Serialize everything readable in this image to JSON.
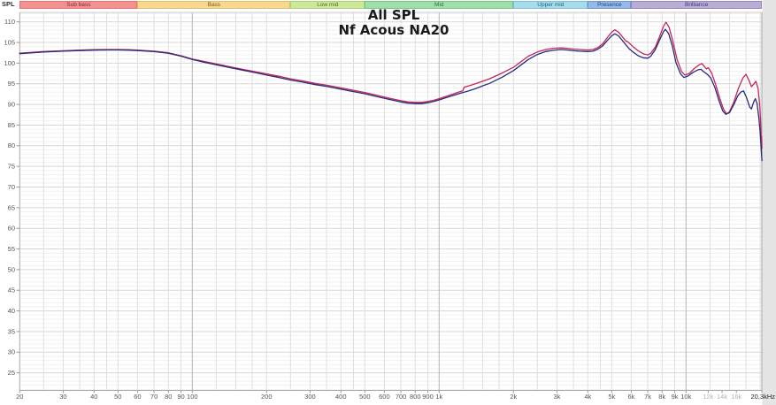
{
  "window": {
    "y_axis_corner_label": "SPL"
  },
  "chart": {
    "title": "All SPL",
    "subtitle": "Nf Acous NA20"
  },
  "colors": {
    "plot_bg": "#ffffff",
    "outside_margin": "#e5e5e5",
    "grid_minor_h": "#f1f1f1",
    "grid_major_h": "#d7d7d7",
    "grid_minor_v": "#dfdfdf",
    "grid_major_v": "#b5b5b5",
    "axis_border": "#a8a8a8",
    "tick_text": "#555555",
    "tick_text_dim": "#b3b3b3",
    "tick_text_edge": "#222222"
  },
  "bands": [
    {
      "label": "Sub bass",
      "f1": 20,
      "f2": 60,
      "fill": "#f59090",
      "border": "#e57373",
      "text": "#7a2e2e"
    },
    {
      "label": "Bass",
      "f1": 60,
      "f2": 250,
      "fill": "#f6d88f",
      "border": "#dfbe68",
      "text": "#6e5a1e"
    },
    {
      "label": "Low mid",
      "f1": 250,
      "f2": 500,
      "fill": "#cce99b",
      "border": "#aed177",
      "text": "#4f6b21"
    },
    {
      "label": "Mid",
      "f1": 500,
      "f2": 2000,
      "fill": "#9fe0aa",
      "border": "#77c487",
      "text": "#2e6e3e"
    },
    {
      "label": "Upper mid",
      "f1": 2000,
      "f2": 4000,
      "fill": "#a8dcec",
      "border": "#7cc0d8",
      "text": "#1f5f78"
    },
    {
      "label": "Presence",
      "f1": 4000,
      "f2": 6000,
      "fill": "#97b9e6",
      "border": "#6f97d0",
      "text": "#24457e"
    },
    {
      "label": "Brilliance",
      "f1": 6000,
      "f2": 20300,
      "fill": "#b7add5",
      "border": "#9588bf",
      "text": "#453a6e"
    }
  ],
  "chart_data": {
    "type": "line",
    "title": "All SPL",
    "subtitle": "Nf Acous NA20",
    "x_scale": "log",
    "x_range_hz": [
      20,
      20300
    ],
    "y_range_db": [
      20.75,
      112.3
    ],
    "ylabel": "SPL",
    "grid": true,
    "legend_position": "none",
    "y_ticks": [
      110,
      105,
      100,
      95,
      90,
      85,
      80,
      75,
      70,
      65,
      60,
      55,
      50,
      45,
      40,
      35,
      30,
      25
    ],
    "x_ticks": [
      {
        "f": 20,
        "label": "20"
      },
      {
        "f": 30,
        "label": "30"
      },
      {
        "f": 40,
        "label": "40"
      },
      {
        "f": 50,
        "label": "50"
      },
      {
        "f": 60,
        "label": "60"
      },
      {
        "f": 70,
        "label": "70"
      },
      {
        "f": 80,
        "label": "80"
      },
      {
        "f": 90,
        "label": "90"
      },
      {
        "f": 100,
        "label": "100"
      },
      {
        "f": 200,
        "label": "200"
      },
      {
        "f": 300,
        "label": "300"
      },
      {
        "f": 400,
        "label": "400"
      },
      {
        "f": 500,
        "label": "500"
      },
      {
        "f": 600,
        "label": "600"
      },
      {
        "f": 700,
        "label": "700"
      },
      {
        "f": 800,
        "label": "800"
      },
      {
        "f": 900,
        "label": "900"
      },
      {
        "f": 1000,
        "label": "1k"
      },
      {
        "f": 2000,
        "label": "2k"
      },
      {
        "f": 3000,
        "label": "3k"
      },
      {
        "f": 4000,
        "label": "4k"
      },
      {
        "f": 5000,
        "label": "5k"
      },
      {
        "f": 6000,
        "label": "6k"
      },
      {
        "f": 7000,
        "label": "7k"
      },
      {
        "f": 8000,
        "label": "8k"
      },
      {
        "f": 9000,
        "label": "9k"
      },
      {
        "f": 10000,
        "label": "10k"
      },
      {
        "f": 12300,
        "label": "12k",
        "dim": true
      },
      {
        "f": 14000,
        "label": "14k",
        "dim": true
      },
      {
        "f": 16000,
        "label": "16k",
        "dim": true
      },
      {
        "f": 20300,
        "label": "20,3kHz",
        "edge": true
      }
    ],
    "grid_minor_multipliers": [
      1,
      1.25,
      1.5,
      1.75,
      2,
      2.5,
      3,
      3.5,
      4,
      4.5,
      5,
      6,
      7,
      8,
      9
    ],
    "grid_major_freqs": [
      100,
      1000,
      10000
    ],
    "series": [
      {
        "name": "trace-red",
        "color": "#c42753",
        "points": [
          [
            20,
            102.4
          ],
          [
            25,
            102.8
          ],
          [
            30,
            103.0
          ],
          [
            35,
            103.15
          ],
          [
            40,
            103.25
          ],
          [
            45,
            103.3
          ],
          [
            50,
            103.3
          ],
          [
            55,
            103.25
          ],
          [
            60,
            103.15
          ],
          [
            70,
            102.9
          ],
          [
            80,
            102.5
          ],
          [
            90,
            101.8
          ],
          [
            100,
            101.0
          ],
          [
            112,
            100.4
          ],
          [
            125,
            99.8
          ],
          [
            140,
            99.2
          ],
          [
            160,
            98.5
          ],
          [
            180,
            97.9
          ],
          [
            200,
            97.4
          ],
          [
            225,
            96.8
          ],
          [
            250,
            96.2
          ],
          [
            280,
            95.7
          ],
          [
            315,
            95.1
          ],
          [
            355,
            94.6
          ],
          [
            400,
            94.0
          ],
          [
            450,
            93.4
          ],
          [
            500,
            92.9
          ],
          [
            560,
            92.2
          ],
          [
            630,
            91.5
          ],
          [
            700,
            90.9
          ],
          [
            750,
            90.6
          ],
          [
            800,
            90.5
          ],
          [
            850,
            90.5
          ],
          [
            900,
            90.7
          ],
          [
            950,
            91.0
          ],
          [
            1000,
            91.4
          ],
          [
            1100,
            92.2
          ],
          [
            1200,
            93.0
          ],
          [
            1245,
            93.3
          ],
          [
            1265,
            94.2
          ],
          [
            1350,
            94.7
          ],
          [
            1500,
            95.6
          ],
          [
            1600,
            96.2
          ],
          [
            1800,
            97.6
          ],
          [
            2000,
            99.0
          ],
          [
            2150,
            100.4
          ],
          [
            2300,
            101.7
          ],
          [
            2500,
            102.7
          ],
          [
            2700,
            103.3
          ],
          [
            2900,
            103.6
          ],
          [
            3100,
            103.7
          ],
          [
            3300,
            103.6
          ],
          [
            3500,
            103.4
          ],
          [
            3700,
            103.3
          ],
          [
            4000,
            103.2
          ],
          [
            4200,
            103.3
          ],
          [
            4400,
            103.8
          ],
          [
            4600,
            104.7
          ],
          [
            4800,
            106.2
          ],
          [
            5000,
            107.5
          ],
          [
            5150,
            108.1
          ],
          [
            5350,
            107.4
          ],
          [
            5550,
            106.2
          ],
          [
            5700,
            105.4
          ],
          [
            5800,
            105.2
          ],
          [
            5900,
            104.8
          ],
          [
            6100,
            104.0
          ],
          [
            6400,
            103.0
          ],
          [
            6700,
            102.3
          ],
          [
            7000,
            102.0
          ],
          [
            7200,
            102.4
          ],
          [
            7500,
            103.8
          ],
          [
            7800,
            106.3
          ],
          [
            8100,
            108.9
          ],
          [
            8300,
            109.9
          ],
          [
            8550,
            108.6
          ],
          [
            8850,
            105.2
          ],
          [
            9200,
            100.9
          ],
          [
            9600,
            97.9
          ],
          [
            9900,
            97.1
          ],
          [
            10300,
            97.5
          ],
          [
            10800,
            98.7
          ],
          [
            11300,
            99.6
          ],
          [
            11600,
            99.9
          ],
          [
            11900,
            99.1
          ],
          [
            12100,
            98.6
          ],
          [
            12300,
            98.9
          ],
          [
            12700,
            97.6
          ],
          [
            13200,
            94.8
          ],
          [
            13700,
            91.5
          ],
          [
            14200,
            88.8
          ],
          [
            14600,
            87.7
          ],
          [
            15000,
            88.2
          ],
          [
            15600,
            90.5
          ],
          [
            16300,
            93.9
          ],
          [
            17000,
            96.4
          ],
          [
            17500,
            97.3
          ],
          [
            18000,
            95.8
          ],
          [
            18400,
            94.3
          ],
          [
            18800,
            94.9
          ],
          [
            19200,
            95.6
          ],
          [
            19600,
            93.8
          ],
          [
            19900,
            89.5
          ],
          [
            20050,
            86.0
          ],
          [
            20150,
            82.0
          ],
          [
            20200,
            80.3
          ],
          [
            20250,
            82.3
          ],
          [
            20300,
            79.3
          ]
        ]
      },
      {
        "name": "trace-blue",
        "color": "#272c7c",
        "points": [
          [
            20,
            102.3
          ],
          [
            25,
            102.7
          ],
          [
            30,
            102.9
          ],
          [
            35,
            103.05
          ],
          [
            40,
            103.15
          ],
          [
            45,
            103.2
          ],
          [
            50,
            103.2
          ],
          [
            55,
            103.15
          ],
          [
            60,
            103.05
          ],
          [
            70,
            102.8
          ],
          [
            80,
            102.4
          ],
          [
            90,
            101.7
          ],
          [
            100,
            100.9
          ],
          [
            112,
            100.2
          ],
          [
            125,
            99.6
          ],
          [
            140,
            99.0
          ],
          [
            160,
            98.3
          ],
          [
            180,
            97.7
          ],
          [
            200,
            97.1
          ],
          [
            225,
            96.5
          ],
          [
            250,
            95.9
          ],
          [
            280,
            95.4
          ],
          [
            315,
            94.8
          ],
          [
            355,
            94.3
          ],
          [
            400,
            93.7
          ],
          [
            450,
            93.1
          ],
          [
            500,
            92.6
          ],
          [
            560,
            91.9
          ],
          [
            630,
            91.2
          ],
          [
            700,
            90.6
          ],
          [
            750,
            90.3
          ],
          [
            800,
            90.2
          ],
          [
            850,
            90.2
          ],
          [
            900,
            90.4
          ],
          [
            950,
            90.7
          ],
          [
            1000,
            91.1
          ],
          [
            1100,
            91.9
          ],
          [
            1200,
            92.6
          ],
          [
            1300,
            93.2
          ],
          [
            1400,
            93.8
          ],
          [
            1500,
            94.5
          ],
          [
            1600,
            95.1
          ],
          [
            1800,
            96.6
          ],
          [
            2000,
            98.2
          ],
          [
            2150,
            99.6
          ],
          [
            2300,
            100.9
          ],
          [
            2500,
            102.1
          ],
          [
            2700,
            102.8
          ],
          [
            2900,
            103.1
          ],
          [
            3100,
            103.3
          ],
          [
            3300,
            103.2
          ],
          [
            3500,
            103.0
          ],
          [
            3700,
            102.9
          ],
          [
            4000,
            102.8
          ],
          [
            4200,
            102.9
          ],
          [
            4400,
            103.4
          ],
          [
            4600,
            104.2
          ],
          [
            4800,
            105.5
          ],
          [
            5000,
            106.6
          ],
          [
            5150,
            107.1
          ],
          [
            5350,
            106.5
          ],
          [
            5550,
            105.3
          ],
          [
            5700,
            104.5
          ],
          [
            5900,
            103.4
          ],
          [
            6100,
            102.7
          ],
          [
            6400,
            101.8
          ],
          [
            6700,
            101.3
          ],
          [
            7000,
            101.2
          ],
          [
            7200,
            101.7
          ],
          [
            7500,
            103.2
          ],
          [
            7800,
            105.5
          ],
          [
            8100,
            107.6
          ],
          [
            8250,
            108.2
          ],
          [
            8500,
            107.2
          ],
          [
            8800,
            104.2
          ],
          [
            9100,
            100.2
          ],
          [
            9500,
            97.4
          ],
          [
            9800,
            96.5
          ],
          [
            10200,
            96.9
          ],
          [
            10700,
            97.8
          ],
          [
            11200,
            98.4
          ],
          [
            11500,
            98.5
          ],
          [
            11800,
            97.9
          ],
          [
            12200,
            97.3
          ],
          [
            12600,
            96.4
          ],
          [
            13100,
            94.1
          ],
          [
            13600,
            90.9
          ],
          [
            14100,
            88.4
          ],
          [
            14500,
            87.6
          ],
          [
            15000,
            88.0
          ],
          [
            15600,
            89.9
          ],
          [
            16200,
            92.1
          ],
          [
            16700,
            93.0
          ],
          [
            17100,
            93.3
          ],
          [
            17600,
            91.6
          ],
          [
            18100,
            89.4
          ],
          [
            18400,
            88.9
          ],
          [
            18800,
            90.6
          ],
          [
            19100,
            91.4
          ],
          [
            19400,
            90.2
          ],
          [
            19700,
            87.0
          ],
          [
            19950,
            83.5
          ],
          [
            20150,
            79.5
          ],
          [
            20300,
            76.4
          ]
        ]
      }
    ]
  }
}
